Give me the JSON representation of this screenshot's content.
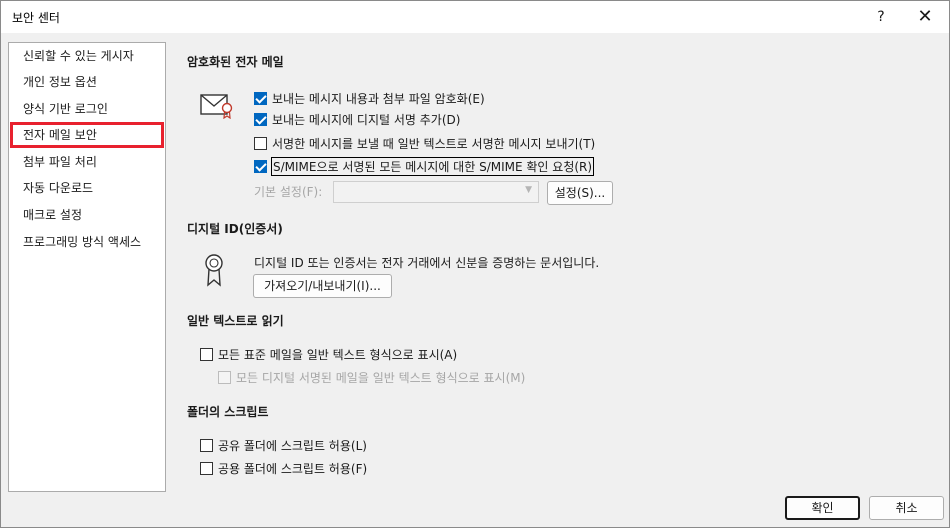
{
  "window": {
    "title": "보안 센터",
    "help_label": "?",
    "close_label": "✕"
  },
  "sidebar": {
    "items": [
      {
        "label": "신뢰할 수 있는 게시자"
      },
      {
        "label": "개인 정보 옵션"
      },
      {
        "label": "양식 기반 로그인"
      },
      {
        "label": "전자 메일 보안",
        "selected": true
      },
      {
        "label": "첨부 파일 처리"
      },
      {
        "label": "자동 다운로드"
      },
      {
        "label": "매크로 설정"
      },
      {
        "label": "프로그래밍 방식 액세스"
      }
    ]
  },
  "encrypted_mail": {
    "title": "암호화된 전자 메일",
    "icon": "envelope-certificate-icon",
    "options": [
      {
        "label": "보내는 메시지 내용과 첨부 파일 암호화(E)",
        "checked": true
      },
      {
        "label": "보내는 메시지에 디지털 서명 추가(D)",
        "checked": true
      },
      {
        "label": "서명한 메시지를 보낼 때 일반 텍스트로 서명한 메시지 보내기(T)",
        "checked": false
      },
      {
        "label": "S/MIME으로 서명된 모든 메시지에 대한 S/MIME 확인 요청(R)",
        "checked": true
      }
    ],
    "default_setting_label": "기본 설정(F):",
    "default_setting_value": "",
    "settings_button": "설정(S)..."
  },
  "digital_id": {
    "title": "디지털 ID(인증서)",
    "icon": "certificate-ribbon-icon",
    "description": "디지털 ID 또는 인증서는 전자 거래에서 신분을 증명하는 문서입니다.",
    "import_export_button": "가져오기/내보내기(I)..."
  },
  "plain_text": {
    "title": "일반 텍스트로 읽기",
    "options": [
      {
        "label": "모든 표준 메일을 일반 텍스트 형식으로 표시(A)",
        "checked": false,
        "enabled": true
      },
      {
        "label": "모든 디지털 서명된 메일을 일반 텍스트 형식으로 표시(M)",
        "checked": false,
        "enabled": false
      }
    ]
  },
  "folder_script": {
    "title": "폴더의 스크립트",
    "options": [
      {
        "label": "공유 폴더에 스크립트 허용(L)",
        "checked": false
      },
      {
        "label": "공용 폴더에 스크립트 허용(F)",
        "checked": false
      }
    ]
  },
  "footer": {
    "ok_button": "확인",
    "cancel_button": "취소"
  }
}
